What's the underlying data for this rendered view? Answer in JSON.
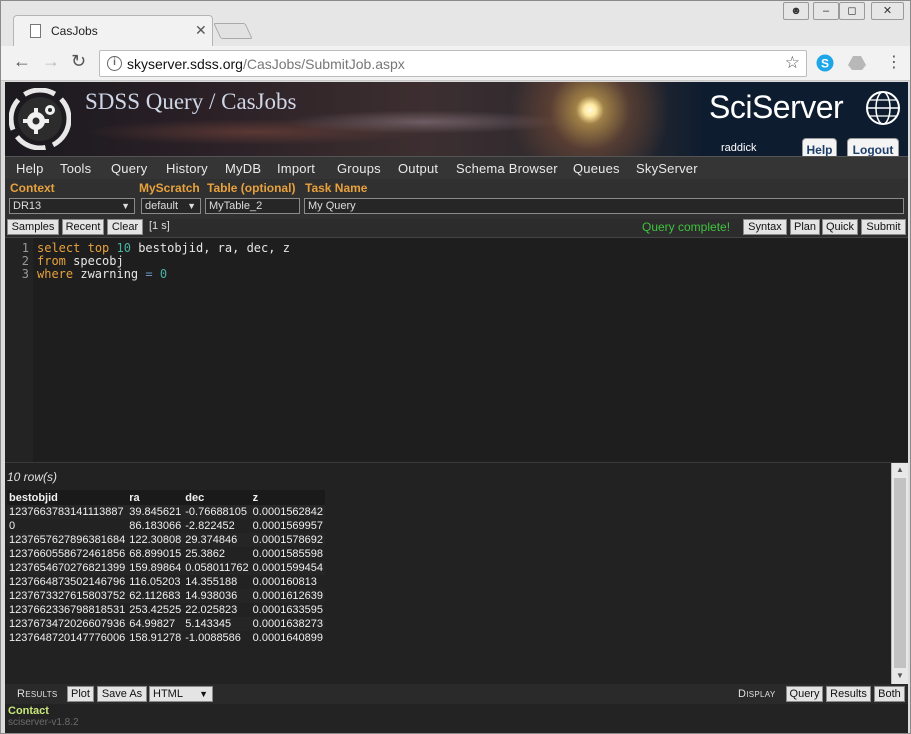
{
  "browser": {
    "tab_title": "CasJobs",
    "url_host": "skyserver.sdss.org",
    "url_path": "/CasJobs/SubmitJob.aspx"
  },
  "header": {
    "title": "SDSS Query / CasJobs",
    "brand": "SciServer",
    "username": "raddick",
    "help_label": "Help",
    "logout_label": "Logout"
  },
  "menu": [
    "Help",
    "Tools",
    "Query",
    "History",
    "MyDB",
    "Import",
    "Groups",
    "Output",
    "Schema Browser",
    "Queues",
    "SkyServer"
  ],
  "context": {
    "context_label": "Context",
    "context_value": "DR13",
    "myscratch_label": "MyScratch",
    "myscratch_value": "default",
    "table_label": "Table (optional)",
    "table_value": "MyTable_2",
    "taskname_label": "Task Name",
    "taskname_value": "My Query"
  },
  "editor_toolbar": {
    "samples": "Samples",
    "recent": "Recent",
    "clear": "Clear",
    "duration": "[1 s]",
    "status": "Query complete!",
    "syntax": "Syntax",
    "plan": "Plan",
    "quick": "Quick",
    "submit": "Submit"
  },
  "editor": {
    "line_numbers": [
      "1",
      "2",
      "3"
    ],
    "line1": {
      "kw1": "select",
      "kw2": "top",
      "num": "10",
      "rest": "bestobjid, ra, dec, z"
    },
    "line2": {
      "kw": "from",
      "rest": "specobj"
    },
    "line3": {
      "kw": "where",
      "field": "zwarning",
      "op": "=",
      "num": "0"
    }
  },
  "results": {
    "row_count": "10 row(s)",
    "columns": [
      "bestobjid",
      "ra",
      "dec",
      "z"
    ],
    "rows": [
      [
        "1237663783141113887",
        "39.845621",
        "-0.76688105",
        "0.0001562842"
      ],
      [
        "0",
        "86.183066",
        "-2.822452",
        "0.0001569957"
      ],
      [
        "1237657627896381684",
        "122.30808",
        "29.374846",
        "0.0001578692"
      ],
      [
        "1237660558672461856",
        "68.899015",
        "25.3862",
        "0.0001585598"
      ],
      [
        "1237654670276821399",
        "159.89864",
        "0.058011762",
        "0.0001599454"
      ],
      [
        "1237664873502146796",
        "116.05203",
        "14.355188",
        "0.000160813"
      ],
      [
        "1237673327615803752",
        "62.112683",
        "14.938036",
        "0.0001612639"
      ],
      [
        "1237662336798818531",
        "253.42525",
        "22.025823",
        "0.0001633595"
      ],
      [
        "1237673472026607936",
        "64.99827",
        "5.143345",
        "0.0001638273"
      ],
      [
        "1237648720147776006",
        "158.91278",
        "-1.0088586",
        "0.0001640899"
      ]
    ]
  },
  "bottom": {
    "results_label": "Results",
    "plot": "Plot",
    "save_as": "Save As",
    "format": "HTML",
    "display_label": "Display",
    "query": "Query",
    "results": "Results",
    "both": "Both"
  },
  "footer": {
    "contact": "Contact",
    "version": "sciserver-v1.8.2"
  }
}
